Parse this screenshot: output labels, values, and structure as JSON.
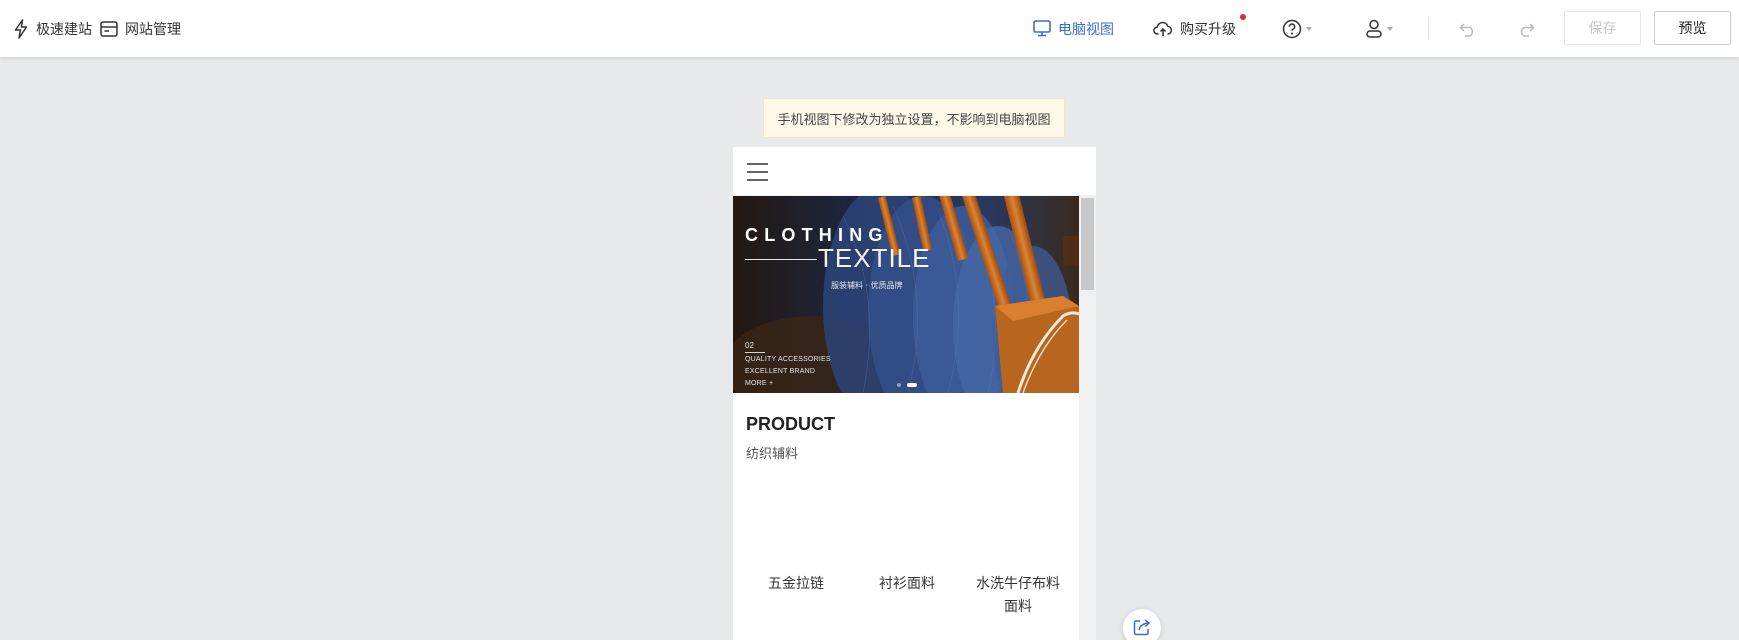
{
  "toolbar": {
    "quick_build": "极速建站",
    "site_manage": "网站管理",
    "pc_view": "电脑视图",
    "buy_upgrade": "购买升级",
    "save": "保存",
    "preview": "预览"
  },
  "colors": {
    "accent": "#3d6bd6",
    "red_dot": "#e02b2b",
    "notice_bg": "#fdf8e8",
    "canvas_bg": "#e8e9eb"
  },
  "notice": "手机视图下修改为独立设置，不影响到电脑视图",
  "banner": {
    "title": "CLOTHING",
    "subtitle": "TEXTILE",
    "tagline": "服装辅料 · 优质品牌",
    "number": "02",
    "line1": "QUALITY ACCESSORIES",
    "line2": "EXCELLENT BRAND",
    "line3": "MORE +"
  },
  "product": {
    "title": "PRODUCT",
    "subtitle": "纺织辅料",
    "categories": [
      "五金拉链",
      "衬衫面料",
      "水洗牛仔布料",
      "面料"
    ]
  },
  "icons": [
    "lightning-icon",
    "site-manage-icon",
    "monitor-icon",
    "cloud-upload-icon",
    "help-icon",
    "user-icon",
    "undo-icon",
    "redo-icon",
    "hamburger-menu-icon",
    "share-icon"
  ]
}
